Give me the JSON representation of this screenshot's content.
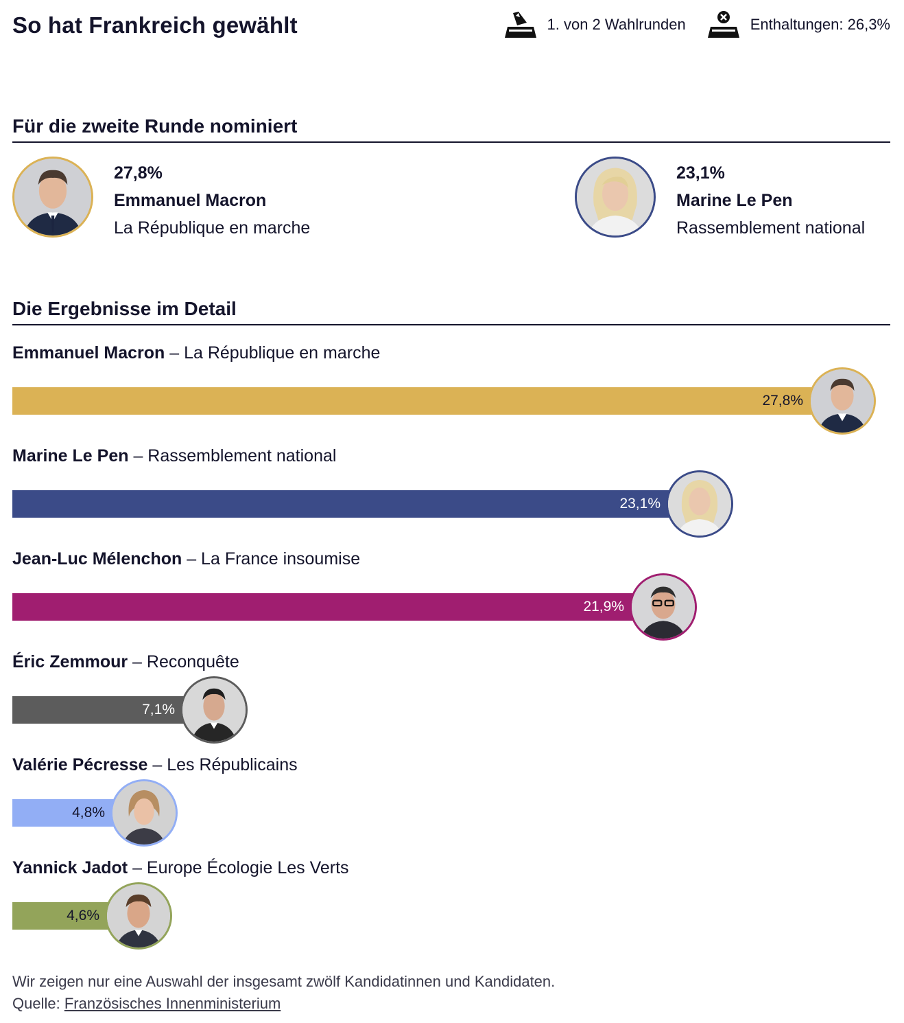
{
  "header": {
    "title": "So hat Frankreich gewählt",
    "round_text": "1. von 2 Wahlrunden",
    "abstention_text": "Enthaltungen: 26,3%"
  },
  "finalists_section": {
    "title": "Für die zweite Runde nominiert",
    "candidates": [
      {
        "pct": "27,8%",
        "name": "Emmanuel Macron",
        "party": "La République en marche",
        "color": "#dbb255"
      },
      {
        "pct": "23,1%",
        "name": "Marine Le Pen",
        "party": "Rassemblement national",
        "color": "#3b4b88"
      }
    ]
  },
  "details_section": {
    "title": "Die Ergebnisse im Detail"
  },
  "chart_data": {
    "type": "bar",
    "orientation": "horizontal",
    "categories": [
      "Emmanuel Macron",
      "Marine Le Pen",
      "Jean-Luc Mélenchon",
      "Éric Zemmour",
      "Valérie Pécresse",
      "Yannick Jadot"
    ],
    "parties": [
      "La République en marche",
      "Rassemblement national",
      "La France insoumise",
      "Reconquête",
      "Les Républicains",
      "Europe Écologie Les Verts"
    ],
    "values": [
      27.8,
      23.1,
      21.9,
      7.1,
      4.8,
      4.6
    ],
    "value_labels": [
      "27,8%",
      "23,1%",
      "21,9%",
      "7,1%",
      "4,8%",
      "4,6%"
    ],
    "colors": [
      "#dbb255",
      "#3b4b88",
      "#a01e70",
      "#5c5c5c",
      "#92aef5",
      "#93a45a"
    ],
    "label_colors": [
      "#14142b",
      "#ffffff",
      "#ffffff",
      "#ffffff",
      "#14142b",
      "#14142b"
    ],
    "unit": "%",
    "grid": false
  },
  "footer": {
    "note": "Wir zeigen nur eine Auswahl der insgesamt zwölf Kandidatinnen und Kandidaten.",
    "source_prefix": "Quelle: ",
    "source_link": "Französisches Innenministerium"
  },
  "icons": {
    "round": "ballot-box-icon",
    "abstention": "ballot-box-cross-icon"
  }
}
